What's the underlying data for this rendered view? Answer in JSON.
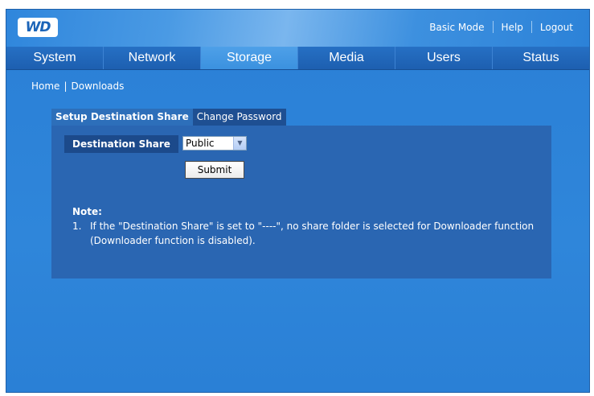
{
  "brand": {
    "logo_text": "WD"
  },
  "toplinks": {
    "basic_mode": "Basic Mode",
    "help": "Help",
    "logout": "Logout"
  },
  "nav": {
    "tabs": [
      {
        "label": "System",
        "active": false
      },
      {
        "label": "Network",
        "active": false
      },
      {
        "label": "Storage",
        "active": true
      },
      {
        "label": "Media",
        "active": false
      },
      {
        "label": "Users",
        "active": false
      },
      {
        "label": "Status",
        "active": false
      }
    ]
  },
  "breadcrumb": {
    "home": "Home",
    "separator": "|",
    "current": "Downloads"
  },
  "subtabs": {
    "active": "Setup Destination Share",
    "inactive": "Change Password"
  },
  "form": {
    "destination_label": "Destination Share",
    "destination_value": "Public",
    "submit_label": "Submit"
  },
  "note": {
    "title": "Note:",
    "items": [
      {
        "num": "1.",
        "text": "If the \"Destination Share\" is set to \"----\", no share folder is selected for Downloader function (Downloader function is disabled)."
      }
    ]
  },
  "colors": {
    "background": "#2a7fd6",
    "panel": "#2a66b2",
    "label_bg": "#1c4a8b",
    "nav_bg": "#1d5fb0"
  }
}
